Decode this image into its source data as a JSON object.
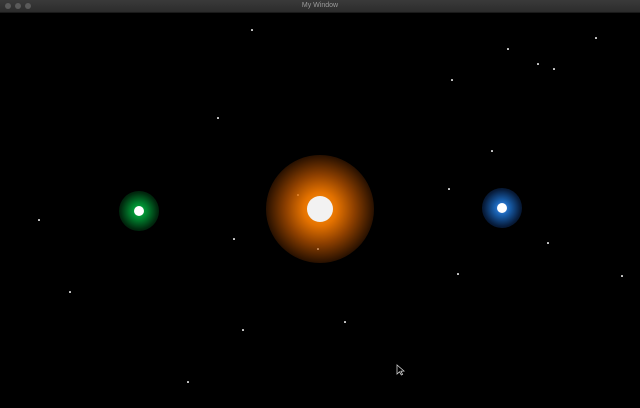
{
  "window": {
    "title": "My Window"
  },
  "scene": {
    "bodies": [
      {
        "name": "sun",
        "glow_color": "#ff8c00",
        "core_color": "#f2f2f2"
      },
      {
        "name": "green-planet",
        "glow_color": "#00c040",
        "core_color": "#ffffff"
      },
      {
        "name": "blue-planet",
        "glow_color": "#1e7ad8",
        "core_color": "#ffffff"
      }
    ],
    "star_color": "#d8d8d8",
    "background": "#000000"
  },
  "icons": {
    "cursor": "mouse-pointer-icon"
  }
}
